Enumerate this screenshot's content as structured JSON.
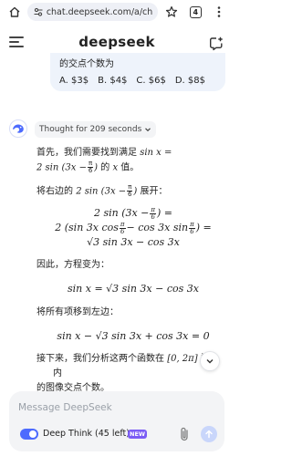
{
  "browser": {
    "url": "chat.deepseek.com/a/ch",
    "tab_count": "4"
  },
  "app": {
    "logo_text": "deepseek"
  },
  "user_message": {
    "line1": "的交点个数为",
    "options": [
      "A. $3$",
      "B. $4$",
      "C. $6$",
      "D. $8$"
    ]
  },
  "thought": {
    "label": "Thought for 209 seconds"
  },
  "answer": {
    "p1_part1": "首先，我们需要找到满足 ",
    "p1_math_inline": "sin x =",
    "p1_part2": " 的 ",
    "p1_part3": " 值。",
    "p1_math_line2_a": "2 sin (3x −",
    "p1_math_x": "x",
    "p2_part1": "将右边的 ",
    "p2_part2": " 展开：",
    "p2_math_inline": "2 sin (3x −",
    "frac_num": "π",
    "frac_den": "6",
    "eq1_line1": "2 sin (3x −",
    "eq1_line1_tail": ") =",
    "eq1_line2_a": "2 (sin 3x cos",
    "eq1_line2_b": "− cos 3x sin",
    "eq1_line2_tail": ") =",
    "eq1_line3": "√3 sin 3x − cos 3x",
    "p3": "因此，方程变为：",
    "eq2": "sin x = √3 sin 3x − cos 3x",
    "p4": "将所有项移到左边：",
    "eq3": "sin x − √3 sin 3x + cos 3x = 0",
    "p5_part1": "接下来，我们分析这两个函数在 ",
    "p5_math": "[0, 2π]",
    "p5_part2": " 门",
    "p5_tail": "内",
    "p5_line2": "的图像交点个数。"
  },
  "composer": {
    "placeholder": "Message DeepSeek",
    "deep_think_label": "Deep Think (45 left)",
    "new_badge": "NEW"
  },
  "colors": {
    "accent": "#4d6bfe",
    "bubble_bg": "#eef3fb",
    "composer_bg": "#f3f4f6",
    "badge": "#7b5cf5"
  },
  "icons": [
    "home-icon",
    "site-settings-icon",
    "star-icon",
    "tab-count-icon",
    "more-icon",
    "menu-icon",
    "new-chat-icon",
    "deepseek-avatar-icon",
    "chevron-down-icon",
    "scroll-down-icon",
    "attach-icon",
    "send-icon"
  ]
}
